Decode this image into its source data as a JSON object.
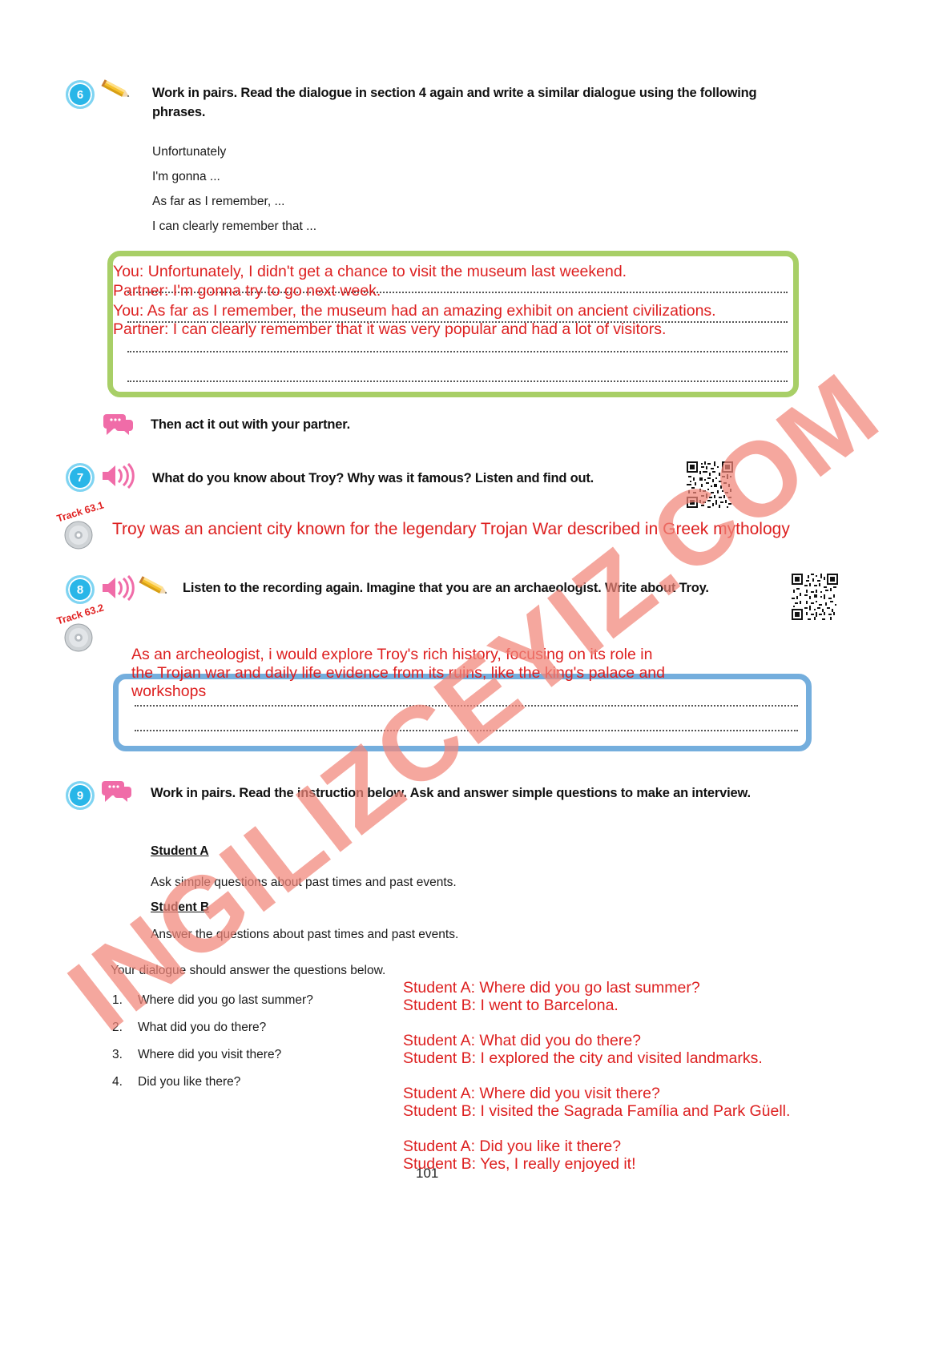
{
  "page": {
    "number": "101",
    "watermark": "INGILIZCEYIZ.COM"
  },
  "exercise6": {
    "number": "6",
    "pencil_icon": "pencil-icon",
    "instruction": "Work in pairs. Read the dialogue in section 4 again and write a similar dialogue using the following phrases.",
    "phrases": [
      "Unfortunately",
      "I'm gonna ...",
      "As far as I remember, ...",
      "I can clearly remember that ..."
    ],
    "answer_lines": [
      "You: Unfortunately, I didn't get a chance to visit the museum last weekend.",
      "Partner: I'm gonna try to go next week.",
      "You: As far as I remember, the museum had an amazing exhibit on ancient civilizations.",
      "Partner: I can clearly remember that it was very popular and had a lot of visitors."
    ],
    "followup": {
      "bubble_icon": "speech-bubble-icon",
      "text": "Then act it out with your partner."
    }
  },
  "exercise7": {
    "number": "7",
    "speaker_icon": "speaker-icon",
    "instruction": "What do you know about Troy? Why was it famous? Listen and find out.",
    "track": "Track 63.1",
    "qr_icon": "qr-code-icon",
    "answer": "Troy was an ancient city known for the legendary Trojan War described in Greek mythology"
  },
  "exercise8": {
    "number": "8",
    "speaker_icon": "speaker-icon",
    "pencil_icon": "pencil-icon",
    "instruction": "Listen to the recording again. Imagine that you are an archaeologist. Write about Troy.",
    "track": "Track 63.2",
    "qr_icon": "qr-code-icon",
    "answer_lines": [
      "As an archeologist, i would explore Troy's rich history, focusing on its role in",
      "the Trojan war and daily life evidence from its ruins, like the king's palace and",
      "workshops"
    ]
  },
  "exercise9": {
    "number": "9",
    "bubble_icon": "speech-bubble-icon",
    "instruction": "Work in pairs. Read the instruction below. Ask and answer simple questions to make an interview.",
    "student_a_heading": "Student A",
    "student_a_text": "Ask simple questions about past times and past events.",
    "student_b_heading": "Student B",
    "student_b_text": "Answer the questions about past times and past events.",
    "lead_in": "Your dialogue should answer the questions below.",
    "questions": [
      {
        "num": "1.",
        "text": "Where did you go last summer?"
      },
      {
        "num": "2.",
        "text": "What did you do there?"
      },
      {
        "num": "3.",
        "text": "Where did you visit there?"
      },
      {
        "num": "4.",
        "text": "Did you like there?"
      }
    ],
    "answer_dialogue": [
      "Student A: Where did you go last summer?",
      "Student B: I went to Barcelona.",
      "",
      "Student A: What did you do there?",
      "Student B: I explored the city and visited landmarks.",
      "",
      "Student A: Where did you visit there?",
      "Student B: I visited the Sagrada Família and Park Güell.",
      "",
      "Student A: Did you like it there?",
      "Student B: Yes, I really enjoyed it!"
    ]
  },
  "colors": {
    "badge": "#29b6e8",
    "green_box": "#a8cf67",
    "blue_box": "#74aedd",
    "pink_icon": "#f06ca8",
    "red_answer": "#dd2020",
    "watermark": "#f2867a"
  }
}
